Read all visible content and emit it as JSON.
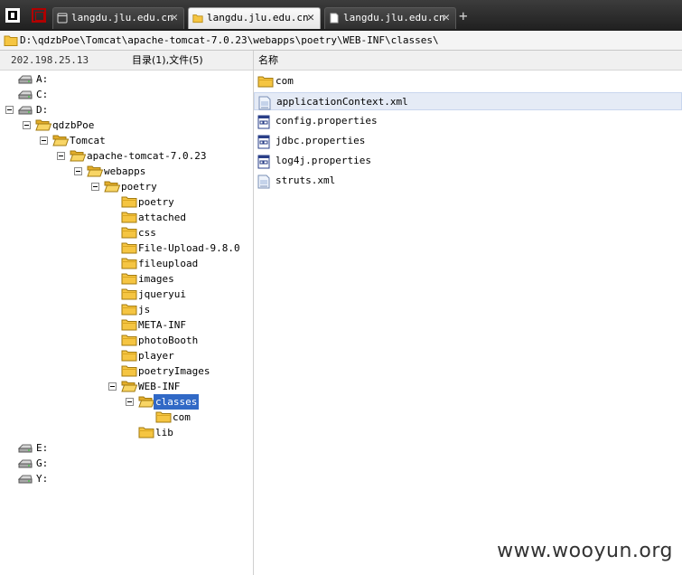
{
  "tabs": [
    {
      "label": "langdu.jlu.edu.cn",
      "icon": "page-icon",
      "active": false
    },
    {
      "label": "langdu.jlu.edu.cn",
      "icon": "folder-icon",
      "active": true
    },
    {
      "label": "langdu.jlu.edu.cn",
      "icon": "document-icon",
      "active": false
    }
  ],
  "tab_close_glyph": "✕",
  "new_tab_glyph": "+",
  "path": "D:\\qdzbPoe\\Tomcat\\apache-tomcat-7.0.23\\webapps\\poetry\\WEB-INF\\classes\\",
  "left_header": {
    "ip": "202.198.25.13",
    "count": "目录(1),文件(5)"
  },
  "right_header": {
    "name_col": "名称"
  },
  "tree": [
    {
      "label": "A:",
      "type": "drive"
    },
    {
      "label": "C:",
      "type": "drive"
    },
    {
      "label": "D:",
      "type": "drive",
      "expanded": true
    },
    {
      "label": "qdzbPoe",
      "type": "folder",
      "expanded": true
    },
    {
      "label": "Tomcat",
      "type": "folder",
      "expanded": true
    },
    {
      "label": "apache-tomcat-7.0.23",
      "type": "folder",
      "expanded": true
    },
    {
      "label": "webapps",
      "type": "folder",
      "expanded": true
    },
    {
      "label": "poetry",
      "type": "folder",
      "expanded": true
    },
    {
      "label": "poetry",
      "type": "folder"
    },
    {
      "label": "attached",
      "type": "folder"
    },
    {
      "label": "css",
      "type": "folder"
    },
    {
      "label": "File-Upload-9.8.0",
      "type": "folder"
    },
    {
      "label": "fileupload",
      "type": "folder"
    },
    {
      "label": "images",
      "type": "folder"
    },
    {
      "label": "jqueryui",
      "type": "folder"
    },
    {
      "label": "js",
      "type": "folder"
    },
    {
      "label": "META-INF",
      "type": "folder"
    },
    {
      "label": "photoBooth",
      "type": "folder"
    },
    {
      "label": "player",
      "type": "folder"
    },
    {
      "label": "poetryImages",
      "type": "folder"
    },
    {
      "label": "WEB-INF",
      "type": "folder",
      "expanded": true
    },
    {
      "label": "classes",
      "type": "folder",
      "expanded": true,
      "selected": true
    },
    {
      "label": "com",
      "type": "folder"
    },
    {
      "label": "lib",
      "type": "folder"
    },
    {
      "label": "E:",
      "type": "drive"
    },
    {
      "label": "G:",
      "type": "drive"
    },
    {
      "label": "Y:",
      "type": "drive"
    }
  ],
  "files": [
    {
      "name": "com",
      "icon": "folder-icon"
    },
    {
      "name": "applicationContext.xml",
      "icon": "xml-file-icon",
      "highlighted": true
    },
    {
      "name": "config.properties",
      "icon": "properties-file-icon"
    },
    {
      "name": "jdbc.properties",
      "icon": "properties-file-icon"
    },
    {
      "name": "log4j.properties",
      "icon": "properties-file-icon"
    },
    {
      "name": "struts.xml",
      "icon": "xml-file-icon"
    }
  ],
  "watermark": "www.wooyun.org",
  "colors": {
    "selection": "#3169c6",
    "folder": "#f5c542",
    "tabbar": "#2a2a2a"
  }
}
